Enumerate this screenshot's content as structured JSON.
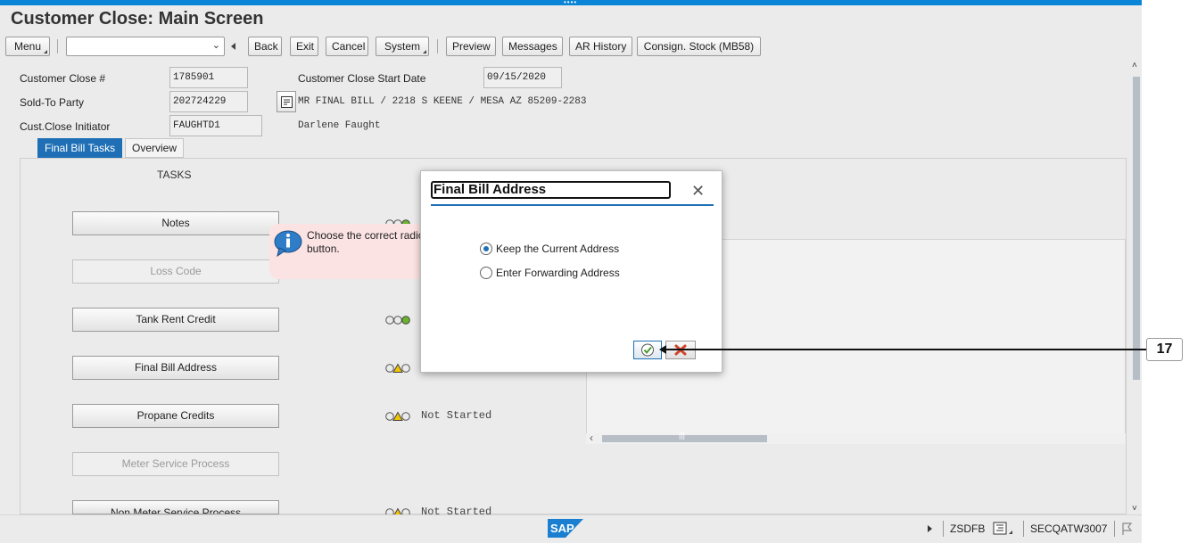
{
  "window": {
    "title": "Customer Close: Main Screen"
  },
  "toolbar": {
    "menu": "Menu",
    "combo_value": "",
    "back": "Back",
    "exit": "Exit",
    "cancel": "Cancel",
    "system": "System",
    "preview": "Preview",
    "messages": "Messages",
    "ar_history": "AR History",
    "consign_stock": "Consign. Stock (MB58)"
  },
  "header": {
    "customer_close_label": "Customer Close #",
    "customer_close_value": "1785901",
    "start_date_label": "Customer Close Start Date",
    "start_date_value": "09/15/2020",
    "sold_to_label": "Sold-To Party",
    "sold_to_value": "202724229",
    "sold_to_address": "MR FINAL BILL / 2218 S KEENE / MESA AZ 85209-2283",
    "initiator_label": "Cust.Close Initiator",
    "initiator_value": "FAUGHTD1",
    "initiator_name": "Darlene Faught"
  },
  "tabs": [
    {
      "label": "Final Bill Tasks",
      "active": true
    },
    {
      "label": "Overview",
      "active": false
    }
  ],
  "tasks": {
    "header": "TASKS",
    "items": [
      {
        "label": "Notes",
        "enabled": true,
        "status": "green",
        "status_text": ""
      },
      {
        "label": "Loss Code",
        "enabled": false,
        "status": "",
        "status_text": ""
      },
      {
        "label": "Tank Rent Credit",
        "enabled": true,
        "status": "green",
        "status_text": ""
      },
      {
        "label": "Final Bill Address",
        "enabled": true,
        "status": "yellow",
        "status_text": ""
      },
      {
        "label": "Propane Credits",
        "enabled": true,
        "status": "yellow",
        "status_text": "Not Started"
      },
      {
        "label": "Meter Service Process",
        "enabled": false,
        "status": "",
        "status_text": ""
      },
      {
        "label": "Non Meter Service Process",
        "enabled": true,
        "status": "yellow",
        "status_text": "Not Started"
      }
    ]
  },
  "tooltip": {
    "text": "Choose the correct radio button."
  },
  "dialog": {
    "title": "Final Bill Address",
    "options": [
      {
        "label": "Keep the Current Address",
        "selected": true
      },
      {
        "label": "Enter Forwarding Address",
        "selected": false
      }
    ]
  },
  "callout": {
    "number": "17"
  },
  "statusbar": {
    "program": "ZSDFB",
    "system": "SECQATW3007"
  },
  "colors": {
    "accent": "#0a84d6",
    "tab_active": "#1e6fb5",
    "status_green": "#6ab42d",
    "status_yellow": "#f2c300"
  }
}
